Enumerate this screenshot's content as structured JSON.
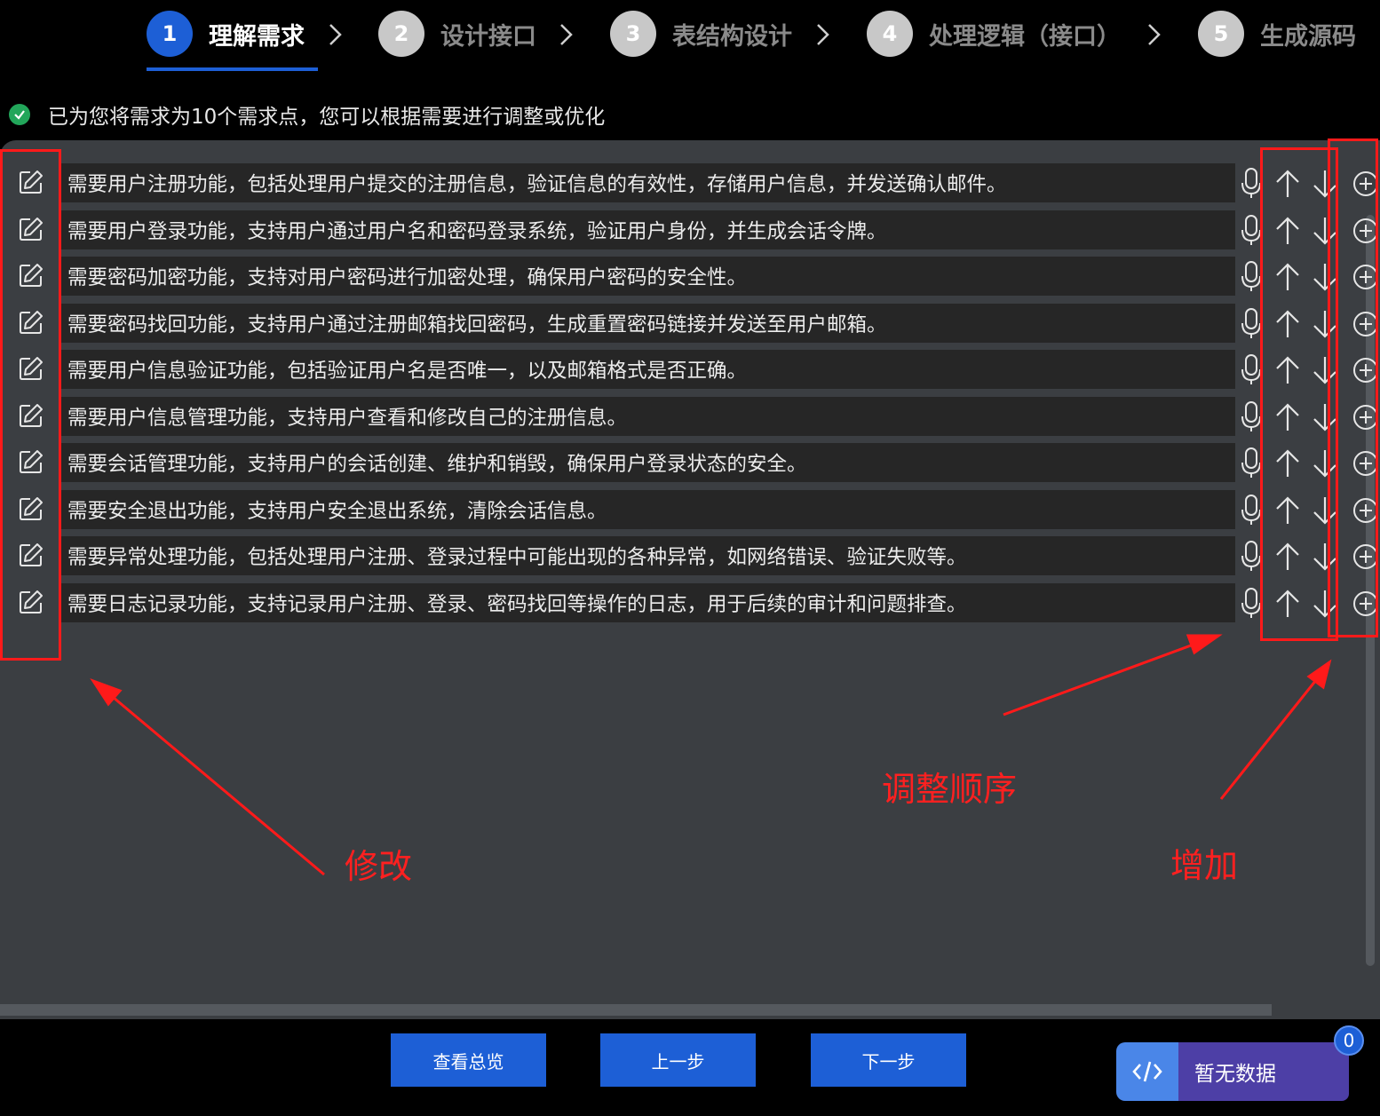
{
  "stepper": {
    "steps": [
      {
        "num": "1",
        "label": "理解需求"
      },
      {
        "num": "2",
        "label": "设计接口"
      },
      {
        "num": "3",
        "label": "表结构设计"
      },
      {
        "num": "4",
        "label": "处理逻辑（接口）"
      },
      {
        "num": "5",
        "label": "生成源码"
      }
    ],
    "active_step": 1
  },
  "status": {
    "message": "已为您将需求为10个需求点，您可以根据需要进行调整或优化"
  },
  "requirements": [
    "需要用户注册功能，包括处理用户提交的注册信息，验证信息的有效性，存储用户信息，并发送确认邮件。",
    "需要用户登录功能，支持用户通过用户名和密码登录系统，验证用户身份，并生成会话令牌。",
    "需要密码加密功能，支持对用户密码进行加密处理，确保用户密码的安全性。",
    "需要密码找回功能，支持用户通过注册邮箱找回密码，生成重置密码链接并发送至用户邮箱。",
    "需要用户信息验证功能，包括验证用户名是否唯一，以及邮箱格式是否正确。",
    "需要用户信息管理功能，支持用户查看和修改自己的注册信息。",
    "需要会话管理功能，支持用户的会话创建、维护和销毁，确保用户登录状态的安全。",
    "需要安全退出功能，支持用户安全退出系统，清除会话信息。",
    "需要异常处理功能，包括处理用户注册、登录过程中可能出现的各种异常，如网络错误、验证失败等。",
    "需要日志记录功能，支持记录用户注册、登录、密码找回等操作的日志，用于后续的审计和问题排查。"
  ],
  "annotations": {
    "edit": "修改",
    "reorder": "调整顺序",
    "add": "增加"
  },
  "footer": {
    "overview_label": "查看总览",
    "prev_label": "上一步",
    "next_label": "下一步"
  },
  "code_widget": {
    "label": "暂无数据",
    "badge_count": "0"
  },
  "colors": {
    "accent": "#1d5fd6",
    "panel": "#3b3e42",
    "row_bg": "#262626",
    "annotation": "#ff1a1a",
    "success": "#22a65a",
    "widget": "#4d3fa6"
  }
}
